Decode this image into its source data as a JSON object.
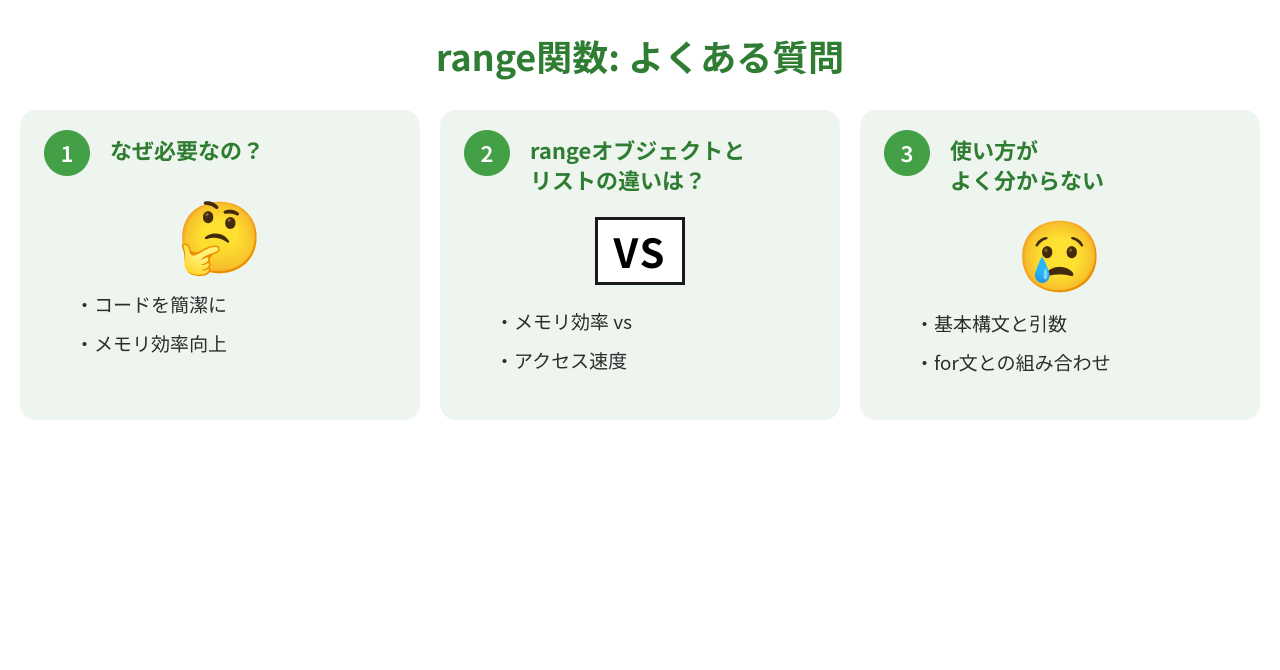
{
  "title": "range関数: よくある質問",
  "cards": [
    {
      "num": "1",
      "title": "なぜ必要なの？",
      "emoji": "🤔",
      "graphic": "emoji",
      "bullets": [
        "コードを簡潔に",
        "メモリ効率向上"
      ]
    },
    {
      "num": "2",
      "title": "rangeオブジェクトと\nリストの違いは？",
      "vs": "VS",
      "graphic": "vs",
      "bullets": [
        "メモリ効率 vs",
        "アクセス速度"
      ]
    },
    {
      "num": "3",
      "title": "使い方が\nよく分からない",
      "emoji": "😢",
      "graphic": "emoji",
      "bullets": [
        "基本構文と引数",
        "for文との組み合わせ"
      ]
    }
  ]
}
